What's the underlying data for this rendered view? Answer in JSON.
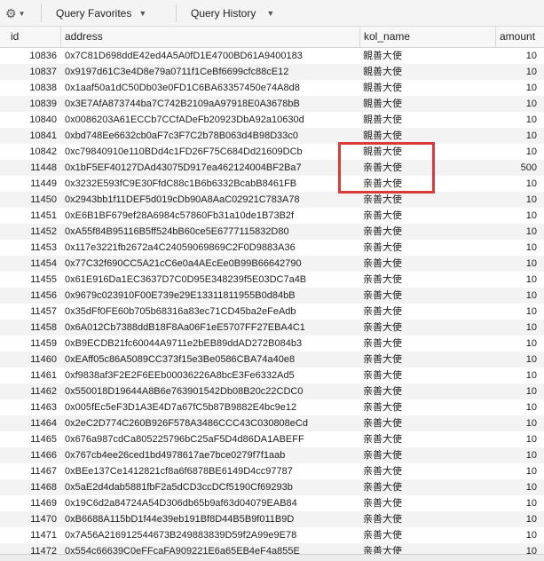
{
  "toolbar": {
    "gear_icon": "gear-icon",
    "query_favorites": "Query Favorites",
    "query_history": "Query History"
  },
  "columns": [
    "id",
    "address",
    "kol_name",
    "amount"
  ],
  "rows": [
    {
      "id": "10836",
      "address": "0x7C81D698ddE42ed4A5A0fD1E4700BD61A9400183",
      "kol_name": "親善大使",
      "amount": "10"
    },
    {
      "id": "10837",
      "address": "0x9197d61C3e4D8e79a0711f1CeBf6699cfc88cE12",
      "kol_name": "親善大使",
      "amount": "10"
    },
    {
      "id": "10838",
      "address": "0x1aaf50a1dC50Db03e0FD1C6BA63357450e74A8d8",
      "kol_name": "親善大使",
      "amount": "10"
    },
    {
      "id": "10839",
      "address": "0x3E7AfA873744ba7C742B2109aA97918E0A3678bB",
      "kol_name": "親善大使",
      "amount": "10"
    },
    {
      "id": "10840",
      "address": "0x0086203A61ECCb7CCfADeFb20923DbA92a10630d",
      "kol_name": "親善大使",
      "amount": "10"
    },
    {
      "id": "10841",
      "address": "0xbd748Ee6632cb0aF7c3F7C2b78B063d4B98D33c0",
      "kol_name": "親善大使",
      "amount": "10"
    },
    {
      "id": "10842",
      "address": "0xc79840910e110BDd4c1FD26F75C684Dd21609DCb",
      "kol_name": "親善大使",
      "amount": "10"
    },
    {
      "id": "11448",
      "address": "0x1bF5EF40127DAd43075D917ea462124004BF2Ba7",
      "kol_name": "亲善大使",
      "amount": "500"
    },
    {
      "id": "11449",
      "address": "0x3232E593fC9E30FfdC88c1B6b6332BcabB8461FB",
      "kol_name": "亲善大使",
      "amount": "10"
    },
    {
      "id": "11450",
      "address": "0x2943bb1f11DEF5d019cDb90A8AaC02921C783A78",
      "kol_name": "亲善大使",
      "amount": "10"
    },
    {
      "id": "11451",
      "address": "0xE6B1BF679ef28A6984c57860Fb31a10de1B73B2f",
      "kol_name": "亲善大使",
      "amount": "10"
    },
    {
      "id": "11452",
      "address": "0xA55f84B95116B5ff524bB60ce5E6777115832D80",
      "kol_name": "亲善大使",
      "amount": "10"
    },
    {
      "id": "11453",
      "address": "0x117e3221fb2672a4C24059069869C2F0D9883A36",
      "kol_name": "亲善大使",
      "amount": "10"
    },
    {
      "id": "11454",
      "address": "0x77C32f690CC5A21cC6e0a4AEcEe0B99B66642790",
      "kol_name": "亲善大使",
      "amount": "10"
    },
    {
      "id": "11455",
      "address": "0x61E916Da1EC3637D7C0D95E348239f5E03DC7a4B",
      "kol_name": "亲善大使",
      "amount": "10"
    },
    {
      "id": "11456",
      "address": "0x9679c023910F00E739e29E13311811955B0d84bB",
      "kol_name": "亲善大使",
      "amount": "10"
    },
    {
      "id": "11457",
      "address": "0x35dFf0FE60b705b68316a83ec71CD45ba2eFeAdb",
      "kol_name": "亲善大使",
      "amount": "10"
    },
    {
      "id": "11458",
      "address": "0x6A012Cb7388ddB18F8Aa06F1eE5707FF27EBA4C1",
      "kol_name": "亲善大使",
      "amount": "10"
    },
    {
      "id": "11459",
      "address": "0xB9ECDB21fc60044A9711e2bEB89ddAD272B084b3",
      "kol_name": "亲善大使",
      "amount": "10"
    },
    {
      "id": "11460",
      "address": "0xEAff05c86A5089CC373f15e3Be0586CBA74a40e8",
      "kol_name": "亲善大使",
      "amount": "10"
    },
    {
      "id": "11461",
      "address": "0xf9838af3F2E2F6EEb00036226A8bcE3Fe6332Ad5",
      "kol_name": "亲善大使",
      "amount": "10"
    },
    {
      "id": "11462",
      "address": "0x550018D19644A8B6e763901542Db08B20c22CDC0",
      "kol_name": "亲善大使",
      "amount": "10"
    },
    {
      "id": "11463",
      "address": "0x005fEc5eF3D1A3E4D7a67fC5b87B9882E4bc9e12",
      "kol_name": "亲善大使",
      "amount": "10"
    },
    {
      "id": "11464",
      "address": "0x2eC2D774C260B926F578A3486CCC43C030808eCd",
      "kol_name": "亲善大使",
      "amount": "10"
    },
    {
      "id": "11465",
      "address": "0x676a987cdCa805225796bC25aF5D4d86DA1ABEFF",
      "kol_name": "亲善大使",
      "amount": "10"
    },
    {
      "id": "11466",
      "address": "0x767cb4ee26ced1bd4978617ae7bce0279f7f1aab",
      "kol_name": "亲善大使",
      "amount": "10"
    },
    {
      "id": "11467",
      "address": "0xBEe137Ce1412821cf8a6f6878BE6149D4cc97787",
      "kol_name": "亲善大使",
      "amount": "10"
    },
    {
      "id": "11468",
      "address": "0x5aE2d4dab5881fbF2a5dCD3ccDCf5190Cf69293b",
      "kol_name": "亲善大使",
      "amount": "10"
    },
    {
      "id": "11469",
      "address": "0x19C6d2a84724A54D306db65b9af63d04079EAB84",
      "kol_name": "亲善大使",
      "amount": "10"
    },
    {
      "id": "11470",
      "address": "0xB6688A115bD1f44e39eb191Bf8D44B5B9f011B9D",
      "kol_name": "亲善大使",
      "amount": "10"
    },
    {
      "id": "11471",
      "address": "0x7A56A216912544673B249883839D59f2A99e9E78",
      "kol_name": "亲善大使",
      "amount": "10"
    },
    {
      "id": "11472",
      "address": "0x554c66639C0eFFcaFA909221E6a65EB4eF4a855E",
      "kol_name": "亲善大使",
      "amount": "10"
    }
  ],
  "colors": {
    "highlight_border": "#d93a3a",
    "alt_row": "#f3f3f3",
    "header_bg": "#f7f7f7"
  }
}
